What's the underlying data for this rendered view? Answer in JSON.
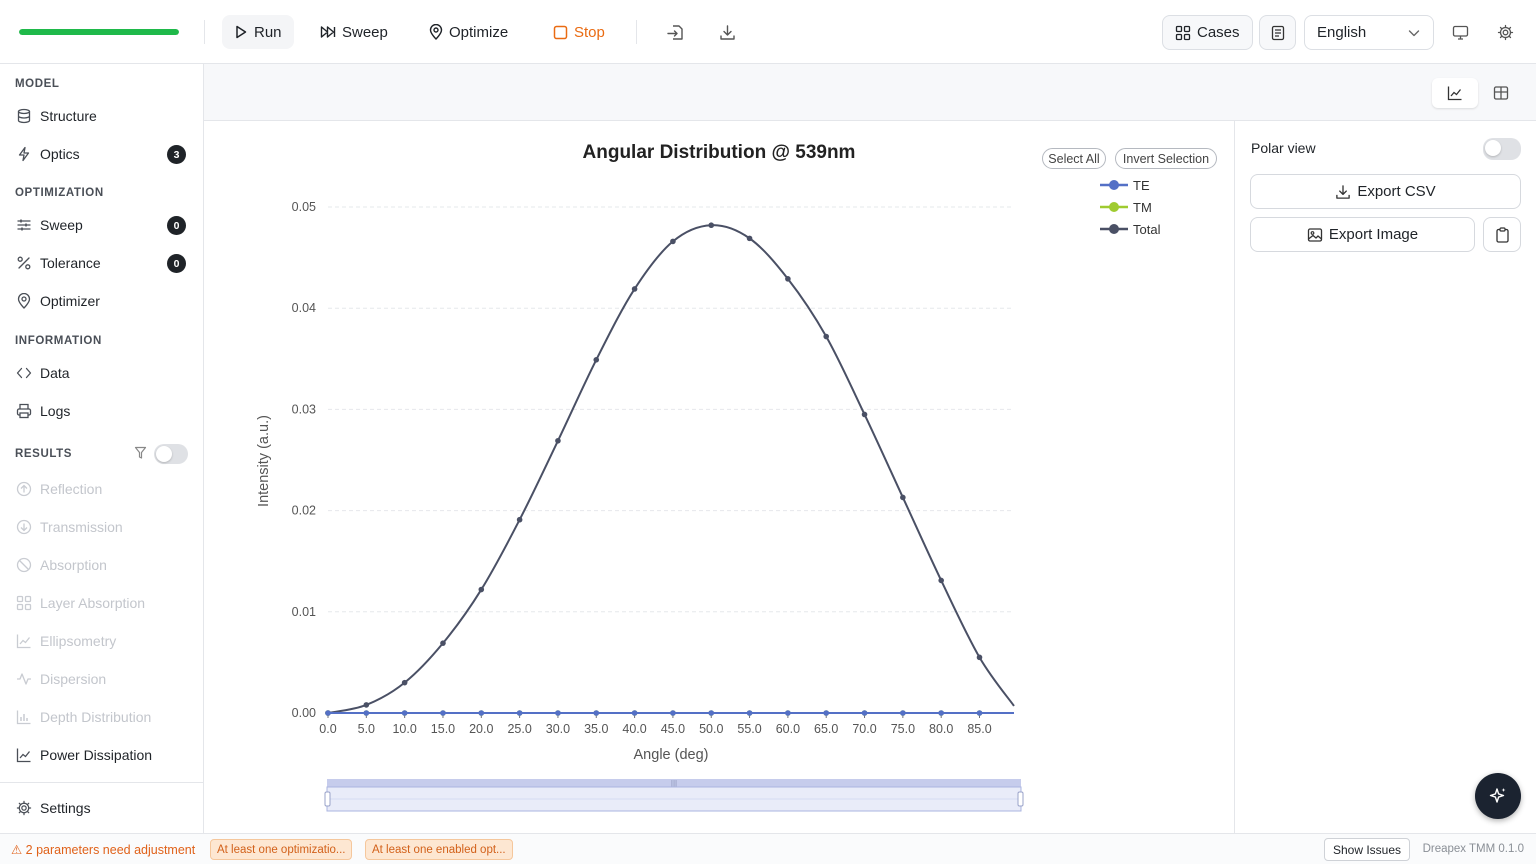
{
  "toolbar": {
    "progress": 1.0,
    "run_label": "Run",
    "sweep_label": "Sweep",
    "optimize_label": "Optimize",
    "stop_label": "Stop",
    "cases_label": "Cases",
    "language": "English"
  },
  "sidebar": {
    "model_heading": "MODEL",
    "structure_label": "Structure",
    "optics_label": "Optics",
    "optics_badge": "3",
    "optimization_heading": "OPTIMIZATION",
    "sweep_label": "Sweep",
    "sweep_badge": "0",
    "tolerance_label": "Tolerance",
    "tolerance_badge": "0",
    "optimizer_label": "Optimizer",
    "information_heading": "INFORMATION",
    "data_label": "Data",
    "logs_label": "Logs",
    "results_heading": "RESULTS",
    "results": [
      {
        "label": "Reflection"
      },
      {
        "label": "Transmission"
      },
      {
        "label": "Absorption"
      },
      {
        "label": "Layer Absorption"
      },
      {
        "label": "Ellipsometry"
      },
      {
        "label": "Dispersion"
      },
      {
        "label": "Depth Distribution"
      },
      {
        "label": "Power Dissipation"
      }
    ],
    "settings_label": "Settings"
  },
  "chart_controls": {
    "select_all": "Select All",
    "invert_selection": "Invert Selection"
  },
  "right_panel": {
    "polar_view_label": "Polar view",
    "export_csv": "Export CSV",
    "export_image": "Export Image"
  },
  "status": {
    "warning": "⚠ 2 parameters need adjustment",
    "chip1": "At least one optimizatio...",
    "chip2": "At least one enabled opt...",
    "show_issues": "Show Issues",
    "version": "Dreapex TMM 0.1.0"
  },
  "chart_data": {
    "type": "line",
    "title": "Angular Distribution @ 539nm",
    "xlabel": "Angle (deg)",
    "ylabel": "Intensity (a.u.)",
    "xlim": [
      0,
      89.5
    ],
    "ylim": [
      0,
      0.05
    ],
    "yticks": [
      "0.00",
      "0.01",
      "0.02",
      "0.03",
      "0.04",
      "0.05"
    ],
    "xticks": [
      "0.0",
      "5.0",
      "10.0",
      "15.0",
      "20.0",
      "25.0",
      "30.0",
      "35.0",
      "40.0",
      "45.0",
      "50.0",
      "55.0",
      "60.0",
      "65.0",
      "70.0",
      "75.0",
      "80.0",
      "85.0"
    ],
    "legend_position": "top-right",
    "grid": true,
    "series": [
      {
        "name": "TE",
        "color": "#5470c6",
        "x": [
          0,
          5,
          10,
          15,
          20,
          25,
          30,
          35,
          40,
          45,
          50,
          55,
          60,
          65,
          70,
          75,
          80,
          85,
          89.5
        ],
        "values": [
          0,
          0,
          0,
          0,
          0,
          0,
          0,
          0,
          0,
          0,
          0,
          0,
          0,
          0,
          0,
          0,
          0,
          0,
          0
        ]
      },
      {
        "name": "TM",
        "color": "#9fcb30",
        "x": [
          0,
          5,
          10,
          15,
          20,
          25,
          30,
          35,
          40,
          45,
          50,
          55,
          60,
          65,
          70,
          75,
          80,
          85,
          89.5
        ],
        "values": [
          0,
          0,
          0,
          0,
          0,
          0,
          0,
          0,
          0,
          0,
          0,
          0,
          0,
          0,
          0,
          0,
          0,
          0,
          0
        ]
      },
      {
        "name": "Total",
        "color": "#4a5065",
        "x": [
          0,
          5,
          10,
          15,
          20,
          25,
          30,
          35,
          40,
          45,
          50,
          55,
          60,
          65,
          70,
          75,
          80,
          85,
          89.5
        ],
        "values": [
          0,
          0.0008,
          0.003,
          0.0069,
          0.0122,
          0.0191,
          0.0269,
          0.0349,
          0.0419,
          0.0466,
          0.0482,
          0.0469,
          0.0429,
          0.0372,
          0.0295,
          0.0213,
          0.0131,
          0.0055,
          0.0007
        ]
      }
    ]
  }
}
